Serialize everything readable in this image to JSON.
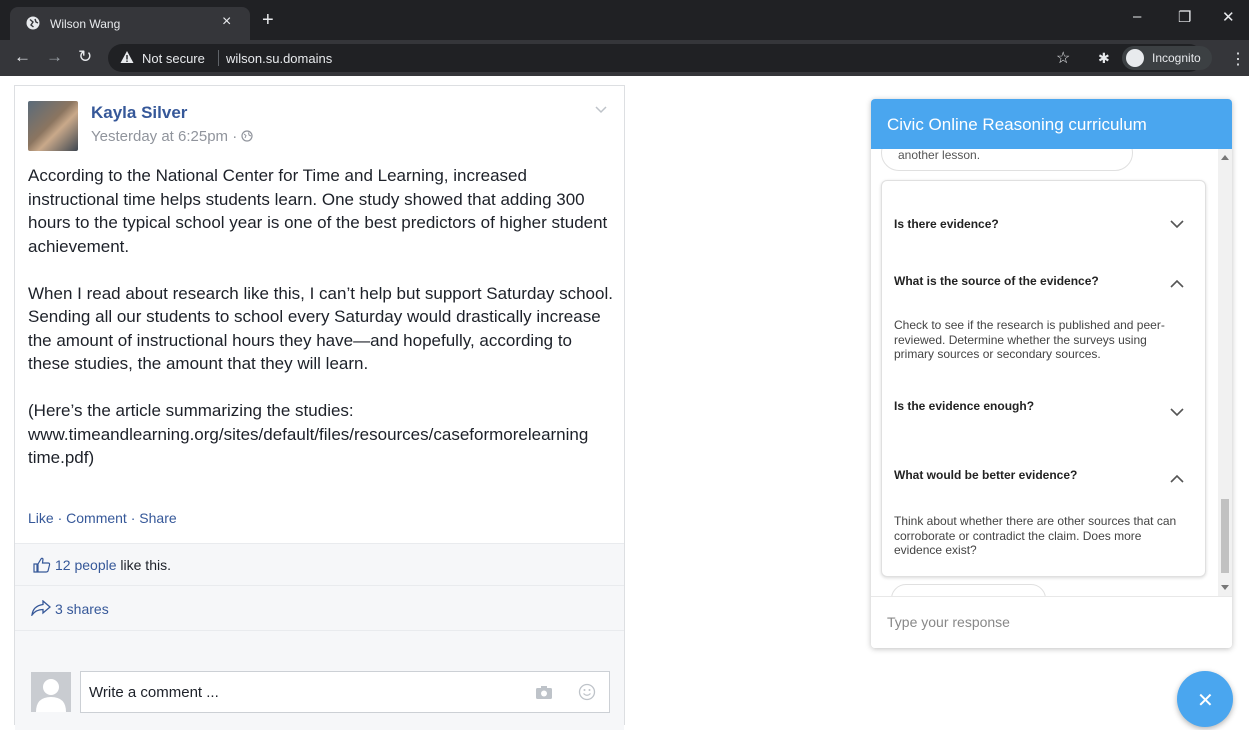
{
  "browser": {
    "tab_title": "Wilson Wang",
    "tab_close": "×",
    "new_tab": "+",
    "not_secure": "Not secure",
    "url": "wilson.su.domains",
    "incognito_label": "Incognito",
    "window_controls": {
      "minimize": "–",
      "restore": "❐",
      "close": "✕"
    }
  },
  "post": {
    "author": "Kayla Silver",
    "timestamp": "Yesterday at 6:25pm ·",
    "paragraphs": [
      "According to the National Center for Time and Learning, increased instructional time helps students learn. One study showed that adding 300 hours to the typical school year is one of the best predictors of higher student achievement.",
      "When I read about research like this, I can’t help but support Saturday school. Sending all our students to school every Saturday would drastically increase the amount of instructional hours they have—and hopefully, according to these studies, the amount that they will learn.",
      "(Here’s the article summarizing the studies: www.timeandlearning.org/sites/default/files/resources/caseformorelearning time.pdf)"
    ],
    "actions": {
      "like": "Like",
      "comment": "Comment",
      "share": "Share",
      "sep": " · "
    },
    "likes_link": "12 people",
    "likes_rest": " like this.",
    "shares": "3 shares",
    "comment_placeholder": "Write a comment ..."
  },
  "widget": {
    "title": "Civic Online Reasoning curriculum",
    "prev_bubble": "another lesson.",
    "items": [
      {
        "question": "Is there evidence?",
        "expanded": false,
        "answer": ""
      },
      {
        "question": "What is the source of the evidence?",
        "expanded": true,
        "answer": "Check to see if the research is published and peer-reviewed. Determine whether the surveys using primary sources or secondary sources."
      },
      {
        "question": "Is the evidence enough?",
        "expanded": false,
        "answer": ""
      },
      {
        "question": "What would be better evidence?",
        "expanded": true,
        "answer": "Think about whether there are other sources that can corroborate or contradict the claim. Does more evidence exist?"
      }
    ],
    "input_placeholder": "Type your response",
    "close_label": "✕"
  },
  "colors": {
    "accent": "#4aa6ef",
    "fb_link": "#365899",
    "chrome_dark": "#202124"
  }
}
